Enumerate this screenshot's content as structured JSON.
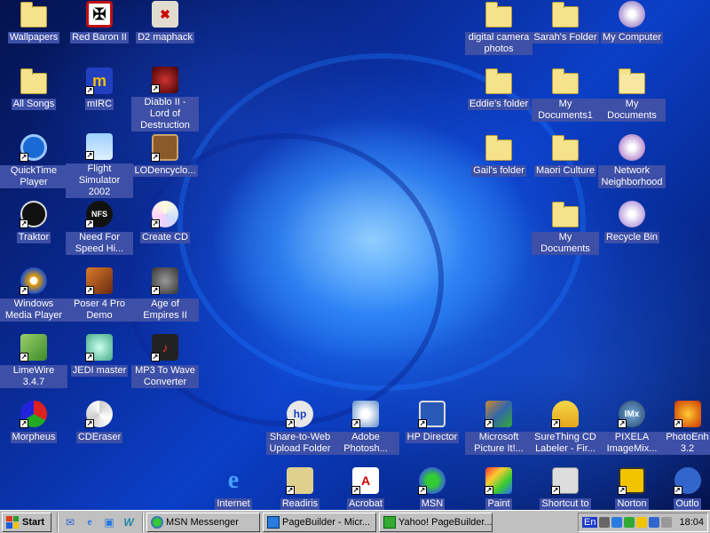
{
  "desktop": {
    "icons": [
      {
        "label": "Wallpapers",
        "icon": "folder-icon"
      },
      {
        "label": "Red Baron II",
        "icon": "red-baron-icon",
        "shortcut": false
      },
      {
        "label": "D2 maphack",
        "icon": "map-icon"
      },
      {
        "label": "digital camera photos",
        "icon": "folder-icon"
      },
      {
        "label": "Sarah's Folder",
        "icon": "folder-icon"
      },
      {
        "label": "My Computer",
        "icon": "my-computer-icon"
      },
      {
        "label": "All Songs",
        "icon": "folder-icon"
      },
      {
        "label": "mIRC",
        "icon": "mirc-icon",
        "shortcut": true
      },
      {
        "label": "Diablo II - Lord of Destruction",
        "icon": "diablo-icon",
        "shortcut": true
      },
      {
        "label": "Eddie's folder",
        "icon": "folder-icon"
      },
      {
        "label": "My Documents1",
        "icon": "folder-icon"
      },
      {
        "label": "My Documents",
        "icon": "my-documents-icon"
      },
      {
        "label": "QuickTime Player",
        "icon": "quicktime-icon",
        "shortcut": true
      },
      {
        "label": "Flight Simulator 2002",
        "icon": "flight-simulator-icon",
        "shortcut": true
      },
      {
        "label": "LODencyclo...",
        "icon": "book-icon",
        "shortcut": true
      },
      {
        "label": "Gail's folder",
        "icon": "folder-icon"
      },
      {
        "label": "Maori Culture",
        "icon": "folder-icon"
      },
      {
        "label": "Network Neighborhood",
        "icon": "network-icon"
      },
      {
        "label": "Traktor",
        "icon": "traktor-icon",
        "shortcut": true
      },
      {
        "label": "Need For Speed Hi...",
        "icon": "nfs-icon",
        "shortcut": true
      },
      {
        "label": "Create CD",
        "icon": "create-cd-icon",
        "shortcut": true
      },
      {
        "label": "My Documents",
        "icon": "folder-icon"
      },
      {
        "label": "Recycle Bin",
        "icon": "recycle-bin-icon"
      },
      {
        "label": "Windows Media Player",
        "icon": "media-player-icon",
        "shortcut": true
      },
      {
        "label": "Poser 4 Pro Demo",
        "icon": "poser-icon",
        "shortcut": true
      },
      {
        "label": "Age of Empires II",
        "icon": "age-of-empires-icon",
        "shortcut": true
      },
      {
        "label": "LimeWire 3.4.7",
        "icon": "limewire-icon",
        "shortcut": true
      },
      {
        "label": "JEDI master",
        "icon": "jedi-icon",
        "shortcut": true
      },
      {
        "label": "MP3 To Wave Converter",
        "icon": "mp3-wave-icon",
        "shortcut": true
      },
      {
        "label": "Morpheus",
        "icon": "morpheus-icon",
        "shortcut": true
      },
      {
        "label": "CDEraser",
        "icon": "cderaser-icon",
        "shortcut": true
      },
      {
        "label": "Share-to-Web Upload Folder",
        "icon": "hp-share-icon",
        "shortcut": true
      },
      {
        "label": "Adobe Photosh...",
        "icon": "photoshop-icon",
        "shortcut": true
      },
      {
        "label": "HP Director",
        "icon": "hp-director-icon",
        "shortcut": true
      },
      {
        "label": "Microsoft Picture It!...",
        "icon": "picture-it-icon",
        "shortcut": true
      },
      {
        "label": "SureThing CD Labeler - Fir...",
        "icon": "surething-icon",
        "shortcut": true
      },
      {
        "label": "PIXELA ImageMix...",
        "icon": "pixela-icon",
        "shortcut": true
      },
      {
        "label": "PhotoEnh 3.2",
        "icon": "photoenh-icon",
        "shortcut": true
      },
      {
        "label": "Internet",
        "icon": "internet-explorer-icon"
      },
      {
        "label": "Readiris",
        "icon": "readiris-icon",
        "shortcut": true
      },
      {
        "label": "Acrobat",
        "icon": "acrobat-icon",
        "shortcut": true
      },
      {
        "label": "MSN",
        "icon": "msn-icon",
        "shortcut": true
      },
      {
        "label": "Paint",
        "icon": "paint-icon",
        "shortcut": true
      },
      {
        "label": "Shortcut to",
        "icon": "shortcut-icon",
        "shortcut": true
      },
      {
        "label": "Norton",
        "icon": "norton-icon",
        "shortcut": true
      },
      {
        "label": "Outlo",
        "icon": "outlook-icon",
        "shortcut": true
      }
    ]
  },
  "taskbar": {
    "start_label": "Start",
    "quick_launch": [
      "outlook-express-icon",
      "ie-icon",
      "desktop-icon",
      "frontpage-icon"
    ],
    "tasks": [
      {
        "label": "MSN Messenger",
        "icon": "msn-messenger-icon"
      },
      {
        "label": "PageBuilder - Micr...",
        "icon": "pagebuilder-icon"
      },
      {
        "label": "Yahoo! PageBuilder...",
        "icon": "yahoo-icon"
      }
    ],
    "tray": {
      "language": "En",
      "time": "18:04"
    }
  },
  "colors": {
    "label_bg": "#3d4fa6",
    "taskbar": "#c0c0c0",
    "folder": "#f5e28a"
  }
}
